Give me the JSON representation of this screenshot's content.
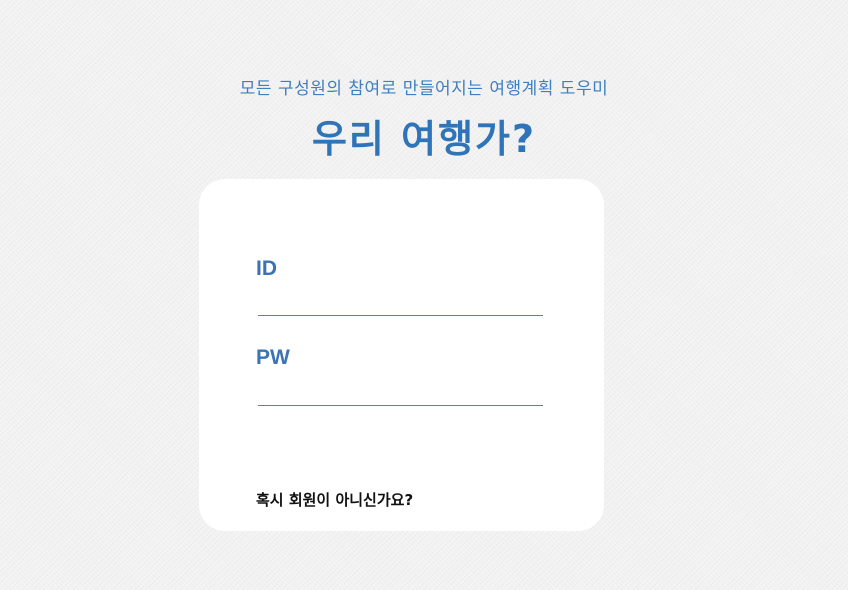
{
  "header": {
    "subtitle": "모든 구성원의 참여로 만들어지는 여행계획 도우미",
    "title": "우리 여행가?"
  },
  "login": {
    "id_label": "ID",
    "pw_label": "PW",
    "id_value": "",
    "pw_value": "",
    "signup_link": "혹시 회원이 아니신가요?"
  },
  "colors": {
    "accent": "#2f74b8",
    "label": "#3b73b4",
    "underline": "#4a86c2",
    "background": "#f1f1f1",
    "card": "#ffffff"
  }
}
